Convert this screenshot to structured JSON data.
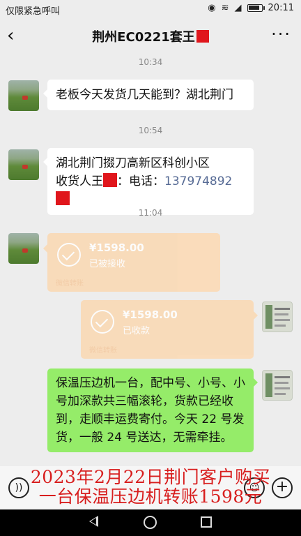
{
  "status": {
    "left_text": "仅限紧急呼叫",
    "time": "20:11"
  },
  "header": {
    "title": "荆州EC0221套王",
    "back_glyph": "‹",
    "more_glyph": "···"
  },
  "messages": {
    "t1": "10:34",
    "m1": "老板今天发货几天能到？湖北荆门",
    "t2": "10:54",
    "m2_line1": "湖北荆门掇刀高新区科创小区",
    "m2_prefix": "收货人王",
    "m2_mid": "：电话：",
    "m2_phone": "137974892",
    "t3": "11:04",
    "tr1_amount": "¥1598.00",
    "tr1_status": "已被接收",
    "tr1_footer": "微信转账",
    "tr2_amount": "¥1598.00",
    "tr2_status": "已收款",
    "tr2_footer": "微信转账",
    "m3": "保温压边机一台，配中号、小号、小号加深款共三幅滚轮，货款已经收到，走顺丰运费寄付。今天 22 号发货，一般 24 号送达，无需牵挂。"
  },
  "overlay": {
    "line1": "2023年2月22日荆门客户购买",
    "line2": "一台保温压边机转账1598元"
  },
  "icons": {
    "voice": "voice-icon",
    "emoji": "emoji-icon",
    "plus": "plus-icon"
  },
  "colors": {
    "bubble_green": "#95ec69",
    "transfer": "#fbd8b2",
    "overlay_red": "#d81e1e"
  }
}
